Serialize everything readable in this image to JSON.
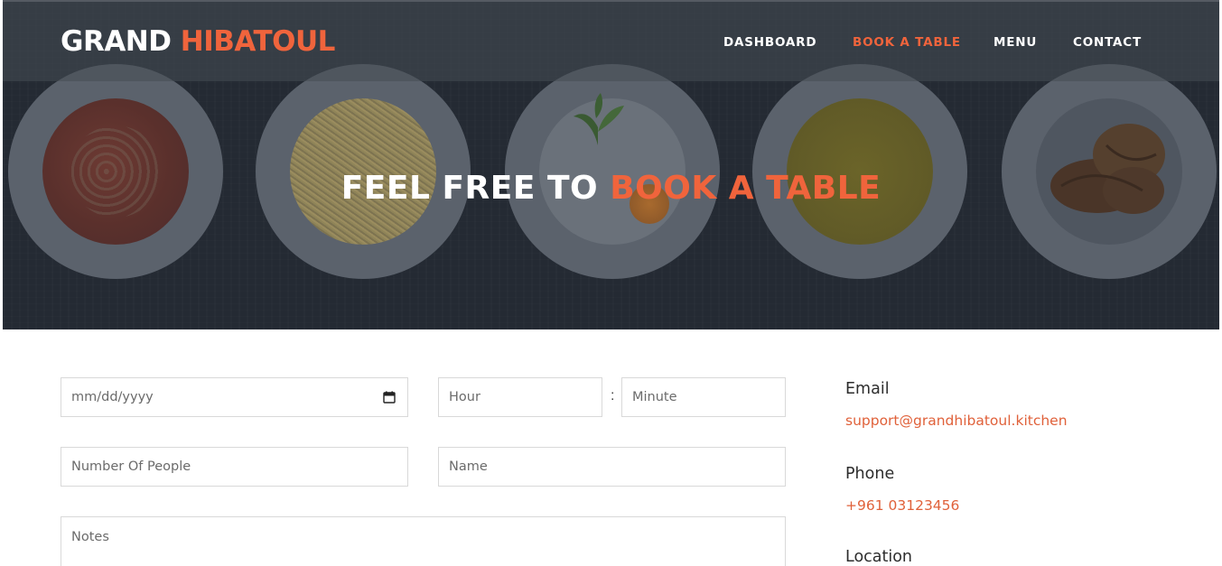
{
  "brand": {
    "part1": "GRAND",
    "part2": "HIBATOUL"
  },
  "nav": {
    "items": [
      {
        "label": "DASHBOARD"
      },
      {
        "label": "BOOK A TABLE",
        "active": true
      },
      {
        "label": "MENU"
      },
      {
        "label": "CONTACT"
      }
    ]
  },
  "hero": {
    "title_part1": "FEEL FREE TO",
    "title_part2": "BOOK A TABLE"
  },
  "form": {
    "date_placeholder": "mm/dd/yyyy",
    "hour_placeholder": "Hour",
    "time_separator": ":",
    "minute_placeholder": "Minute",
    "people_placeholder": "Number Of People",
    "name_placeholder": "Name",
    "notes_placeholder": "Notes"
  },
  "contact": {
    "email_label": "Email",
    "email_value": "support@grandhibatoul.kitchen",
    "phone_label": "Phone",
    "phone_value": "+961 03123456",
    "location_label": "Location"
  },
  "colors": {
    "accent": "#f0643c",
    "hero_bg": "#242a33"
  }
}
